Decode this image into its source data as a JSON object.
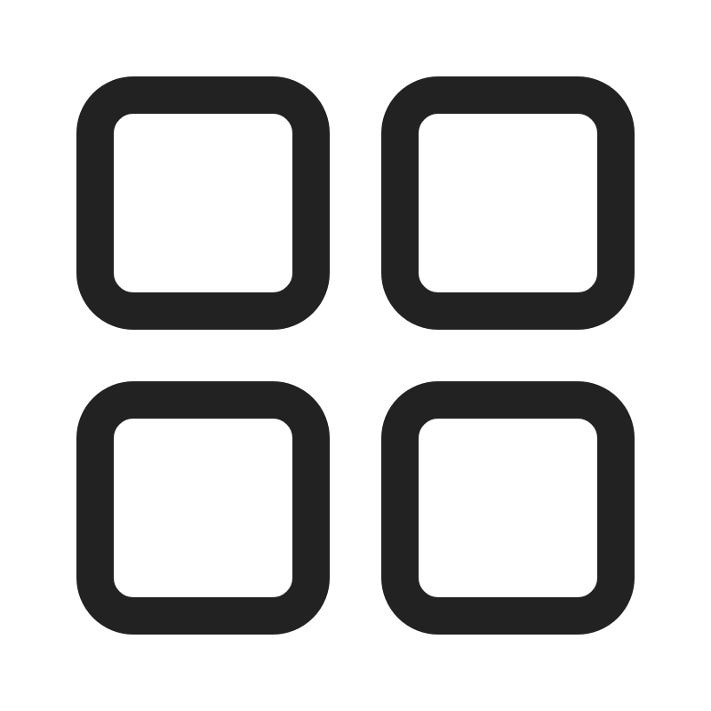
{
  "icon": {
    "name": "grid-view-icon",
    "stroke_color": "#222222",
    "background_color": "#ffffff",
    "tiles": [
      {
        "name": "grid-tile-top-left-icon"
      },
      {
        "name": "grid-tile-top-right-icon"
      },
      {
        "name": "grid-tile-bottom-left-icon"
      },
      {
        "name": "grid-tile-bottom-right-icon"
      }
    ]
  }
}
